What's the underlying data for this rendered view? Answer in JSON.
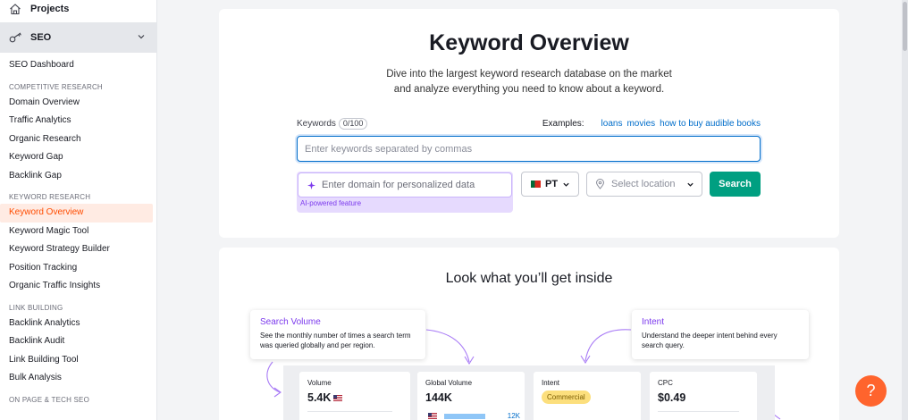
{
  "sidebar": {
    "projects_label": "Projects",
    "seo_label": "SEO",
    "dashboard_label": "SEO Dashboard",
    "sections": [
      {
        "heading": "COMPETITIVE RESEARCH",
        "items": [
          "Domain Overview",
          "Traffic Analytics",
          "Organic Research",
          "Keyword Gap",
          "Backlink Gap"
        ]
      },
      {
        "heading": "KEYWORD RESEARCH",
        "items": [
          "Keyword Overview",
          "Keyword Magic Tool",
          "Keyword Strategy Builder",
          "Position Tracking",
          "Organic Traffic Insights"
        ]
      },
      {
        "heading": "LINK BUILDING",
        "items": [
          "Backlink Analytics",
          "Backlink Audit",
          "Link Building Tool",
          "Bulk Analysis"
        ]
      },
      {
        "heading": "ON PAGE & TECH SEO",
        "items": []
      }
    ],
    "active_item": "Keyword Overview"
  },
  "main": {
    "title": "Keyword Overview",
    "subtitle_line1": "Dive into the largest keyword research database on the market",
    "subtitle_line2": "and analyze everything you need to know about a keyword.",
    "keywords_label": "Keywords",
    "keywords_counter": "0/100",
    "examples_label": "Examples:",
    "examples": [
      "loans",
      "movies",
      "how to buy audible books"
    ],
    "keyword_input_placeholder": "Enter keywords separated by commas",
    "domain_input_placeholder": "Enter domain for personalized data",
    "ai_caption": "AI-powered feature",
    "database_value": "PT",
    "location_placeholder": "Select location",
    "search_button": "Search"
  },
  "inside": {
    "title": "Look what you’ll get inside",
    "tip_search_volume": {
      "title": "Search Volume",
      "text": "See the monthly number of times a search term was queried globally and per region."
    },
    "tip_intent": {
      "title": "Intent",
      "text": "Understand the deeper intent behind every search query."
    },
    "preview": {
      "volume_label": "Volume",
      "volume_value": "5.4K",
      "global_volume_label": "Global Volume",
      "global_volume_value": "144K",
      "global_volume_row_value": "12K",
      "global_volume_bar_fraction": 0.46,
      "intent_label": "Intent",
      "intent_value": "Commercial",
      "cpc_label": "CPC",
      "cpc_value": "$0.49"
    }
  },
  "help_button": "?",
  "colors": {
    "accent_blue": "#006dca",
    "search_green": "#009f81",
    "active_orange": "#ff4c00",
    "ai_purple": "#7c3aed",
    "help_orange": "#ff642d"
  }
}
